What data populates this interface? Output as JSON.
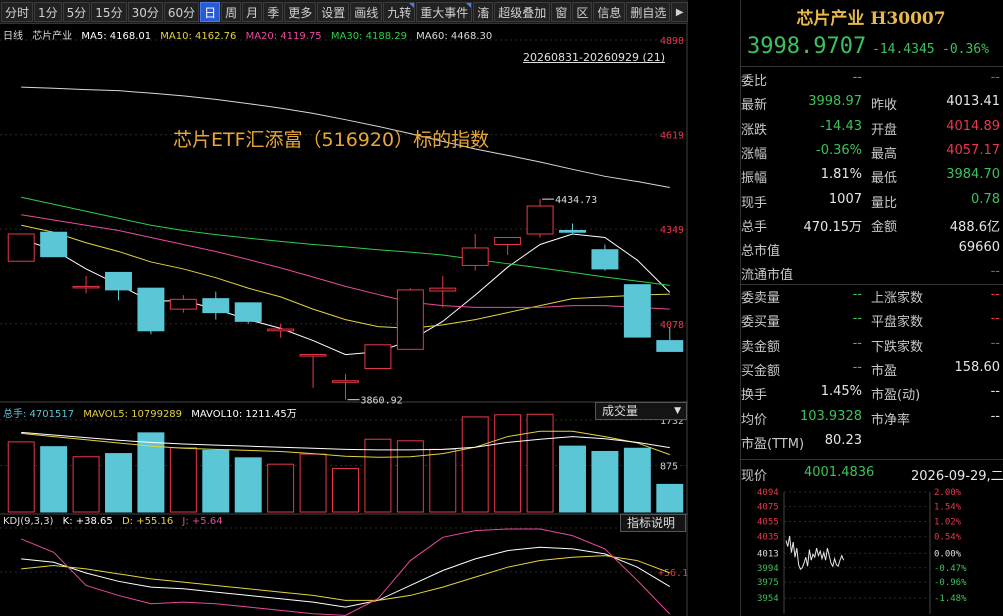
{
  "toolbar": {
    "items": [
      "分时",
      "1分",
      "5分",
      "15分",
      "30分",
      "60分",
      "日",
      "周",
      "月",
      "季",
      "更多",
      "设置",
      "画线",
      "九转",
      "重大事件",
      "滀",
      "超级叠加",
      "窗",
      "区",
      "信息",
      "删自选"
    ],
    "active": "日",
    "arrow": "▶"
  },
  "main_header": {
    "period": "日线",
    "name": "芯片产业",
    "ma5": "MA5: 4168.01",
    "ma10": "MA10: 4162.76",
    "ma20": "MA20: 4119.75",
    "ma30": "MA30: 4188.29",
    "ma60": "MA60: 4468.30"
  },
  "range_label": "20260831-20260929 (21)",
  "annotation": "芯片ETF汇添富（516920）标的指数",
  "volume_header": {
    "label": "总手: 4701517",
    "mavol5": "MAVOL5: 10799289",
    "mavol10": "MAVOL10: 1211.45万"
  },
  "volume_selector": "成交量",
  "kdj_header": {
    "label": "KDJ(9,3,3)",
    "k": "K: +38.65",
    "d": "D: +55.16",
    "j": "J: +5.64"
  },
  "kdj_button": "指标说明",
  "colors": {
    "up": "#e8394a",
    "down": "#5bc6d6",
    "ma5": "#ffffff",
    "ma10": "#e5d33d",
    "ma20": "#e84a9c",
    "ma30": "#2fce4b",
    "ma60": "#d8d8d8",
    "accent": "#e8a637"
  },
  "chart_data": [
    {
      "type": "candlestick",
      "title": "芯片产业 日线",
      "ylim": [
        3860,
        4890
      ],
      "yticks": [
        4078,
        4349,
        4619,
        4890
      ],
      "candles": [
        {
          "o": 4257,
          "h": 4335,
          "l": 4257,
          "c": 4335
        },
        {
          "o": 4340,
          "h": 4340,
          "l": 4270,
          "c": 4270
        },
        {
          "o": 4185,
          "h": 4215,
          "l": 4165,
          "c": 4185
        },
        {
          "o": 4225,
          "h": 4225,
          "l": 4145,
          "c": 4175
        },
        {
          "o": 4180,
          "h": 4180,
          "l": 4048,
          "c": 4058
        },
        {
          "o": 4120,
          "h": 4160,
          "l": 4110,
          "c": 4148
        },
        {
          "o": 4150,
          "h": 4170,
          "l": 4090,
          "c": 4110
        },
        {
          "o": 4138,
          "h": 4138,
          "l": 4078,
          "c": 4085
        },
        {
          "o": 4058,
          "h": 4078,
          "l": 4038,
          "c": 4063
        },
        {
          "o": 3990,
          "h": 3990,
          "l": 3895,
          "c": 3990
        },
        {
          "o": 3915,
          "h": 3935,
          "l": 3861,
          "c": 3915
        },
        {
          "o": 3950,
          "h": 4018,
          "l": 3950,
          "c": 4018
        },
        {
          "o": 4005,
          "h": 4180,
          "l": 4005,
          "c": 4175
        },
        {
          "o": 4172,
          "h": 4215,
          "l": 4125,
          "c": 4180
        },
        {
          "o": 4245,
          "h": 4335,
          "l": 4230,
          "c": 4295
        },
        {
          "o": 4305,
          "h": 4325,
          "l": 4275,
          "c": 4325
        },
        {
          "o": 4335,
          "h": 4435,
          "l": 4325,
          "c": 4415
        },
        {
          "o": 4345,
          "h": 4365,
          "l": 4333,
          "c": 4340
        },
        {
          "o": 4290,
          "h": 4305,
          "l": 4230,
          "c": 4235
        },
        {
          "o": 4190,
          "h": 4190,
          "l": 4040,
          "c": 4040
        },
        {
          "o": 4030,
          "h": 4068,
          "l": 3998,
          "c": 3999
        }
      ],
      "series": [
        {
          "name": "MA5",
          "values": [
            4320,
            4290,
            4235,
            4190,
            4142,
            4145,
            4120,
            4090,
            4065,
            4030,
            3990,
            3998,
            4030,
            4085,
            4160,
            4240,
            4305,
            4335,
            4325,
            4260,
            4168
          ]
        },
        {
          "name": "MA10",
          "values": [
            4360,
            4340,
            4310,
            4285,
            4255,
            4235,
            4210,
            4180,
            4155,
            4120,
            4090,
            4070,
            4065,
            4075,
            4090,
            4110,
            4130,
            4150,
            4155,
            4160,
            4163
          ]
        },
        {
          "name": "MA20",
          "values": [
            4390,
            4375,
            4360,
            4345,
            4325,
            4305,
            4285,
            4262,
            4238,
            4212,
            4185,
            4162,
            4140,
            4130,
            4125,
            4125,
            4125,
            4130,
            4130,
            4125,
            4120
          ]
        },
        {
          "name": "MA30",
          "values": [
            4440,
            4420,
            4400,
            4380,
            4360,
            4345,
            4333,
            4323,
            4314,
            4305,
            4298,
            4290,
            4283,
            4275,
            4262,
            4250,
            4238,
            4225,
            4212,
            4200,
            4188
          ]
        },
        {
          "name": "MA60",
          "values": [
            4755,
            4752,
            4748,
            4745,
            4738,
            4730,
            4720,
            4708,
            4695,
            4680,
            4662,
            4643,
            4622,
            4600,
            4578,
            4560,
            4541,
            4520,
            4500,
            4485,
            4468
          ]
        }
      ],
      "annotations": [
        {
          "label": "4434.73",
          "x_index": 16,
          "value": 4434.73
        },
        {
          "label": "3860.92",
          "x_index": 10,
          "value": 3860.92
        }
      ]
    },
    {
      "type": "bar",
      "title": "成交量",
      "ylim": [
        0,
        1732
      ],
      "yticks": [
        875,
        1732
      ],
      "values": [
        1320,
        1230,
        1040,
        1100,
        1490,
        1210,
        1160,
        1020,
        900,
        1090,
        820,
        1370,
        1340,
        1180,
        1790,
        1830,
        1840,
        1240,
        1140,
        1200,
        520
      ],
      "series": [
        {
          "name": "MAVOL5",
          "values": [
            1480,
            1420,
            1360,
            1300,
            1240,
            1200,
            1180,
            1160,
            1140,
            1100,
            1050,
            1030,
            1040,
            1100,
            1220,
            1420,
            1520,
            1520,
            1420,
            1300,
            1080
          ]
        },
        {
          "name": "MAVOL10",
          "values": [
            1500,
            1450,
            1400,
            1350,
            1310,
            1280,
            1260,
            1240,
            1220,
            1200,
            1180,
            1170,
            1170,
            1180,
            1220,
            1310,
            1370,
            1420,
            1380,
            1310,
            1211
          ]
        }
      ]
    },
    {
      "type": "line",
      "title": "KDJ(9,3,3)",
      "ylim": [
        5.64,
        109.2
      ],
      "yticks": [
        56.17,
        109.2
      ],
      "series": [
        {
          "name": "K",
          "values": [
            72,
            68,
            55,
            45,
            38,
            36,
            32,
            28,
            24,
            20,
            14,
            22,
            40,
            58,
            72,
            82,
            86,
            84,
            78,
            62,
            38.65
          ]
        },
        {
          "name": "D",
          "values": [
            60,
            64,
            60,
            54,
            48,
            44,
            40,
            36,
            32,
            28,
            22,
            22,
            28,
            38,
            50,
            62,
            70,
            74,
            76,
            70,
            55.16
          ]
        },
        {
          "name": "J",
          "values": [
            96,
            80,
            40,
            28,
            18,
            20,
            18,
            14,
            10,
            6,
            4,
            24,
            70,
            98,
            106,
            108,
            108,
            100,
            84,
            46,
            5.64
          ]
        }
      ]
    },
    {
      "type": "line",
      "title": "现价",
      "ylim": [
        3933,
        4094
      ],
      "yticks": [
        4094,
        4075,
        4055,
        4035,
        4013,
        3994,
        3975,
        3954
      ],
      "pct_ticks": [
        "2.00%",
        "1.54%",
        "1.02%",
        "0.54%",
        "0.00%",
        "-0.47%",
        "-0.96%",
        "-1.48%"
      ],
      "values": [
        4030,
        4022,
        4036,
        4014,
        4028,
        4008,
        4020,
        3998,
        3992,
        3994,
        4000,
        4008,
        3996,
        4018,
        4004,
        4012,
        4008,
        4020,
        4010,
        4016,
        4006,
        4014,
        4004,
        4020,
        4010,
        4000,
        3996,
        4006,
        3998,
        3996,
        4004,
        4010,
        4004
      ]
    }
  ],
  "panel": {
    "title": "芯片产业 H30007",
    "price": "3998.9707",
    "change": "-14.4345",
    "change_pct": "-0.36%",
    "rows_a": [
      {
        "l1": "委比",
        "v1": "--",
        "l2": "",
        "v2": "--"
      },
      {
        "l1": "最新",
        "v1": "3998.97",
        "l2": "昨收",
        "v2": "4013.41"
      },
      {
        "l1": "涨跌",
        "v1": "-14.43",
        "l2": "开盘",
        "v2": "4014.89"
      },
      {
        "l1": "涨幅",
        "v1": "-0.36%",
        "l2": "最高",
        "v2": "4057.17"
      },
      {
        "l1": "振幅",
        "v1": "1.81%",
        "l2": "最低",
        "v2": "3984.70"
      },
      {
        "l1": "现手",
        "v1": "1007",
        "l2": "量比",
        "v2": "0.78"
      },
      {
        "l1": "总手",
        "v1": "470.15万",
        "l2": "金额",
        "v2": "488.6亿"
      },
      {
        "l1": "总市值",
        "v1": "",
        "l2": "",
        "v2": "69660"
      },
      {
        "l1": "流通市值",
        "v1": "",
        "l2": "",
        "v2": "--"
      }
    ],
    "rows_b": [
      {
        "l1": "委卖量",
        "v1": "--",
        "l2": "上涨家数",
        "v2": "--"
      },
      {
        "l1": "委买量",
        "v1": "--",
        "l2": "平盘家数",
        "v2": "--"
      },
      {
        "l1": "卖金额",
        "v1": "--",
        "l2": "下跌家数",
        "v2": "--"
      },
      {
        "l1": "买金额",
        "v1": "--",
        "l2": "市盈",
        "v2": "158.60"
      },
      {
        "l1": "换手",
        "v1": "1.45%",
        "l2": "市盈(动)",
        "v2": "--"
      },
      {
        "l1": "均价",
        "v1": "103.9328",
        "l2": "市净率",
        "v2": "--"
      },
      {
        "l1": "市盈(TTM)",
        "v1": "80.23",
        "l2": "",
        "v2": ""
      }
    ],
    "now_label": "现价",
    "now_value": "4001.4836",
    "now_time": "2026-09-29,二"
  }
}
